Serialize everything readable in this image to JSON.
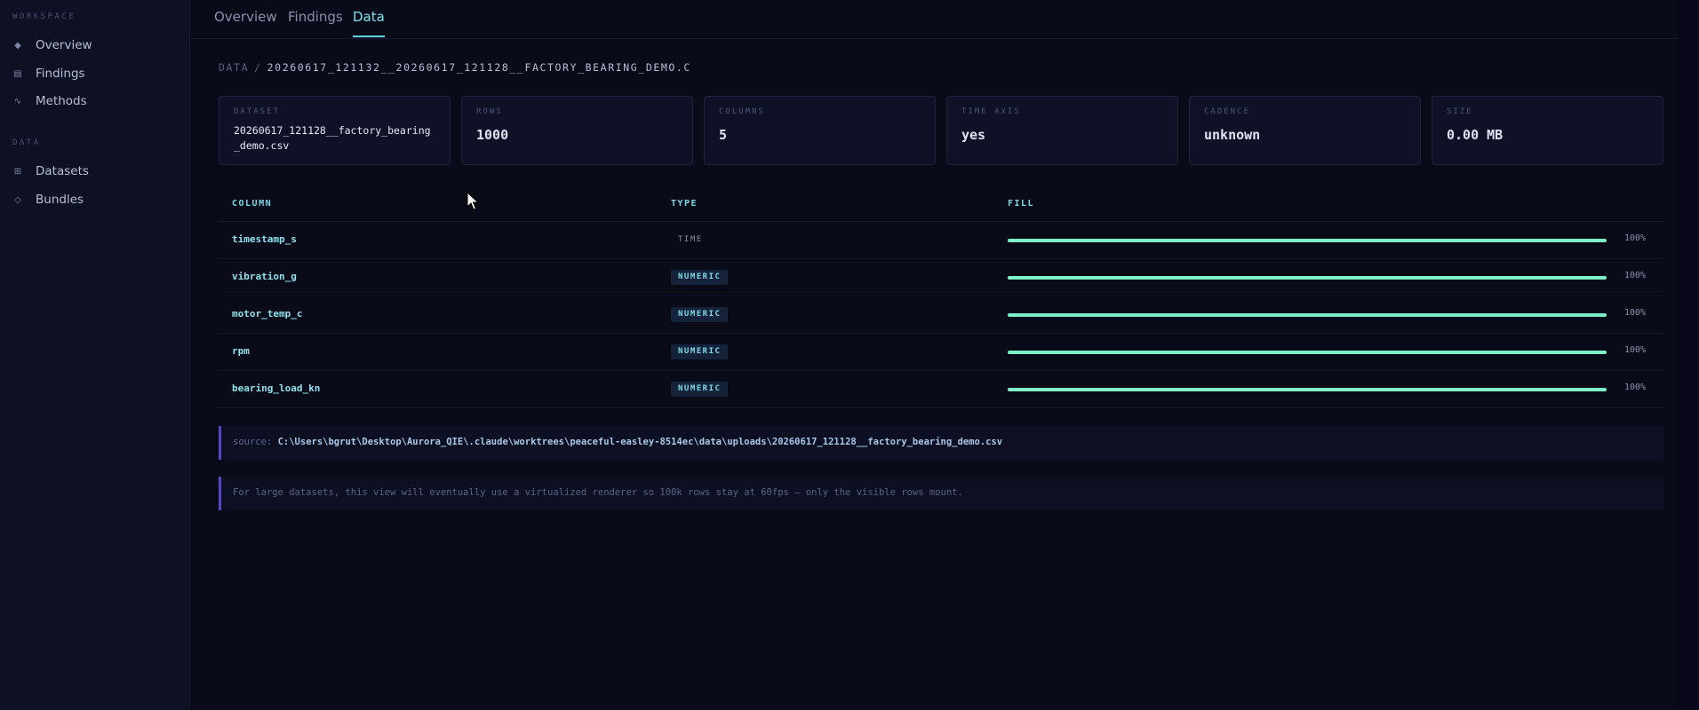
{
  "sidebar": {
    "sections": [
      {
        "title": "WORKSPACE",
        "items": [
          {
            "label": "Overview",
            "icon": "diamond-icon"
          },
          {
            "label": "Findings",
            "icon": "list-icon"
          },
          {
            "label": "Methods",
            "icon": "wave-icon"
          }
        ]
      },
      {
        "title": "DATA",
        "items": [
          {
            "label": "Datasets",
            "icon": "grid-icon"
          },
          {
            "label": "Bundles",
            "icon": "diamond-outline-icon"
          }
        ]
      }
    ]
  },
  "tabs": [
    {
      "label": "Overview",
      "active": false
    },
    {
      "label": "Findings",
      "active": false
    },
    {
      "label": "Data",
      "active": true
    }
  ],
  "breadcrumb": {
    "root": "DATA",
    "separator": "/",
    "path": "20260617_121132__20260617_121128__FACTORY_BEARING_DEMO.C"
  },
  "cards": [
    {
      "label": "DATASET",
      "value": "20260617_121128__factory_bearing_demo.csv"
    },
    {
      "label": "ROWS",
      "value": "1000"
    },
    {
      "label": "COLUMNS",
      "value": "5"
    },
    {
      "label": "TIME AXIS",
      "value": "yes"
    },
    {
      "label": "CADENCE",
      "value": "unknown"
    },
    {
      "label": "SIZE",
      "value": "0.00 MB"
    }
  ],
  "table": {
    "headers": {
      "column": "COLUMN",
      "type": "TYPE",
      "fill": "FILL"
    },
    "rows": [
      {
        "name": "timestamp_s",
        "type": "TIME",
        "fill": 1.0,
        "fill_label": "100%"
      },
      {
        "name": "vibration_g",
        "type": "NUMERIC",
        "fill": 1.0,
        "fill_label": "100%"
      },
      {
        "name": "motor_temp_c",
        "type": "NUMERIC",
        "fill": 1.0,
        "fill_label": "100%"
      },
      {
        "name": "rpm",
        "type": "NUMERIC",
        "fill": 1.0,
        "fill_label": "100%"
      },
      {
        "name": "bearing_load_kn",
        "type": "NUMERIC",
        "fill": 1.0,
        "fill_label": "100%"
      }
    ]
  },
  "source": {
    "label": "source:",
    "path": "C:\\Users\\bgrut\\Desktop\\Aurora_QIE\\.claude\\worktrees\\peaceful-easley-8514ec\\data\\uploads\\20260617_121128__factory_bearing_demo.csv"
  },
  "info_note": "For large datasets, this view will eventually use a virtualized renderer so 100k rows stay at 60fps — only the visible rows mount.",
  "colors": {
    "accent": "#7fd9e4",
    "fill_bar": "#7ef0c9",
    "note_border": "#5a45c7",
    "background": "#0a0b18"
  }
}
